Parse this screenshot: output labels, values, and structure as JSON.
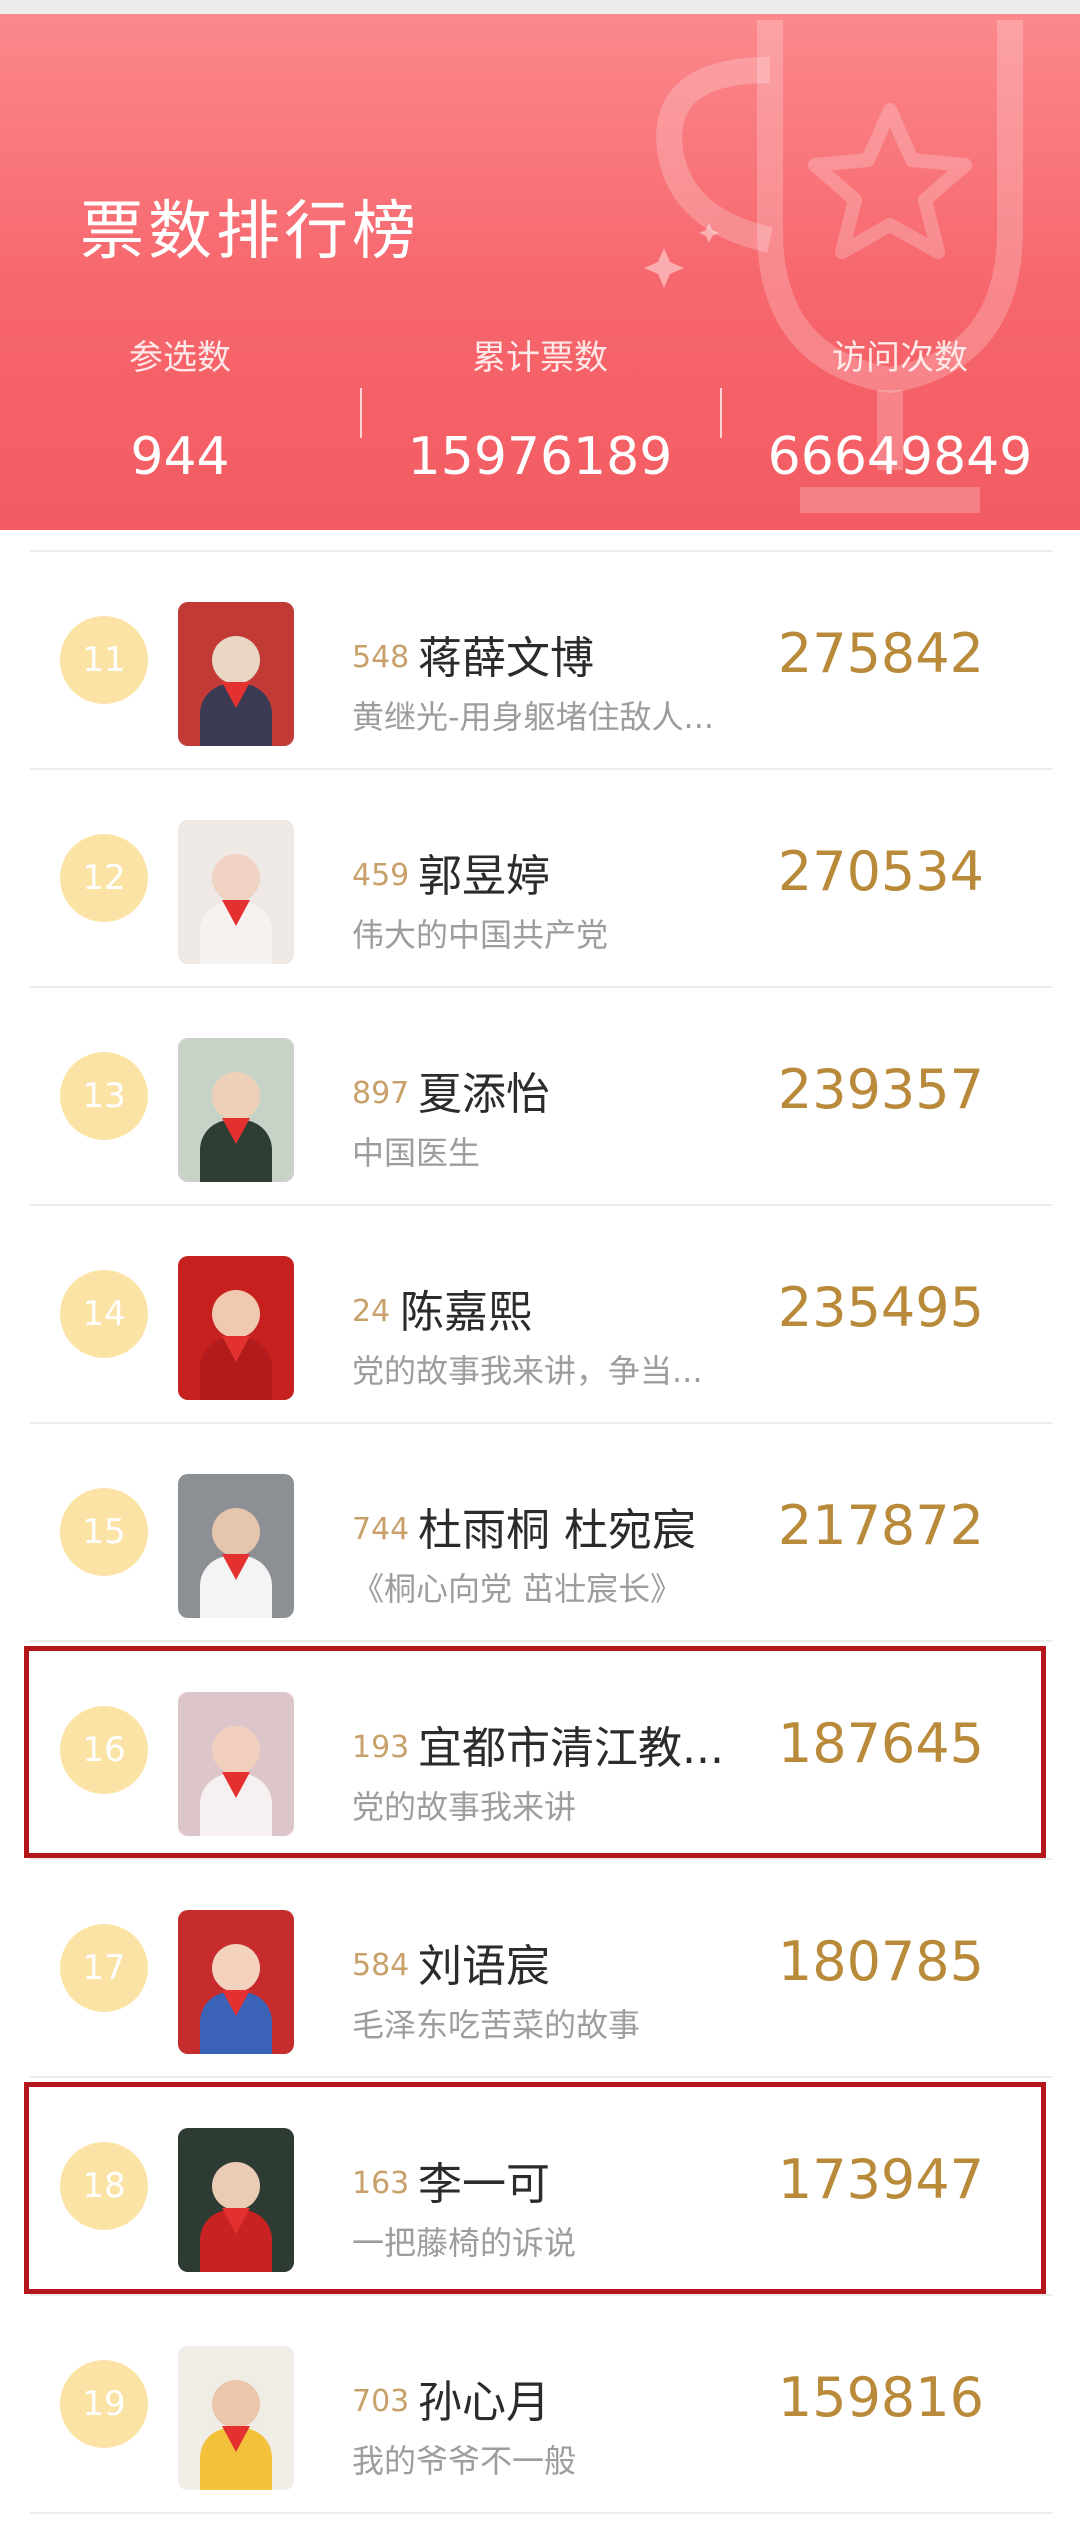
{
  "header": {
    "title": "票数排行榜",
    "stats": [
      {
        "label": "参选数",
        "value": "944"
      },
      {
        "label": "累计票数",
        "value": "15976189"
      },
      {
        "label": "访问次数",
        "value": "66649849"
      }
    ]
  },
  "colors": {
    "header_bg": "#f6666c",
    "rank_badge": "#fbe3a6",
    "vote_text": "#b98a3a",
    "entry_id_text": "#c8a06a",
    "highlight_border": "#b4161b"
  },
  "rows": [
    {
      "rank": "11",
      "entry_id": "548",
      "name": "蒋薛文博",
      "desc": "黄继光-用身躯堵住敌人...",
      "votes": "275842",
      "highlighted": false
    },
    {
      "rank": "12",
      "entry_id": "459",
      "name": "郭昱婷",
      "desc": "伟大的中国共产党",
      "votes": "270534",
      "highlighted": false
    },
    {
      "rank": "13",
      "entry_id": "897",
      "name": "夏添怡",
      "desc": "中国医生",
      "votes": "239357",
      "highlighted": false
    },
    {
      "rank": "14",
      "entry_id": "24",
      "name": "陈嘉熙",
      "desc": "党的故事我来讲，争当...",
      "votes": "235495",
      "highlighted": false
    },
    {
      "rank": "15",
      "entry_id": "744",
      "name": "杜雨桐 杜宛宸",
      "desc": "《桐心向党 茁壮宸长》",
      "votes": "217872",
      "highlighted": false
    },
    {
      "rank": "16",
      "entry_id": "193",
      "name": "宜都市清江教...",
      "desc": "党的故事我来讲",
      "votes": "187645",
      "highlighted": true
    },
    {
      "rank": "17",
      "entry_id": "584",
      "name": "刘语宸",
      "desc": "毛泽东吃苦菜的故事",
      "votes": "180785",
      "highlighted": false
    },
    {
      "rank": "18",
      "entry_id": "163",
      "name": "李一可",
      "desc": "一把藤椅的诉说",
      "votes": "173947",
      "highlighted": true
    },
    {
      "rank": "19",
      "entry_id": "703",
      "name": "孙心月",
      "desc": "我的爷爷不一般",
      "votes": "159816",
      "highlighted": false
    }
  ]
}
